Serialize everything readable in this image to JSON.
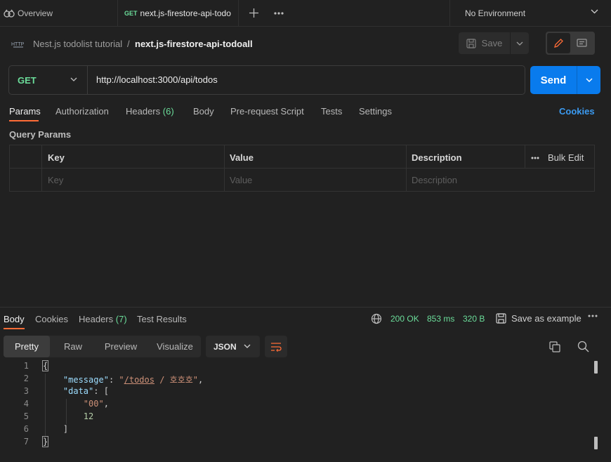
{
  "tabs": {
    "overview_label": "Overview",
    "request_method": "GET",
    "request_label": "next.js-firestore-api-todo",
    "environment": "No Environment"
  },
  "breadcrumb": {
    "parent": "Nest.js todolist tutorial",
    "separator": "/",
    "current": "next.js-firestore-api-todoall"
  },
  "toolbar": {
    "save_label": "Save"
  },
  "request": {
    "method": "GET",
    "url": "http://localhost:3000/api/todos",
    "send_label": "Send"
  },
  "request_tabs": {
    "params": "Params",
    "authorization": "Authorization",
    "headers": "Headers",
    "headers_count": "(6)",
    "body": "Body",
    "pre_request": "Pre-request Script",
    "tests": "Tests",
    "settings": "Settings",
    "cookies": "Cookies"
  },
  "query_params": {
    "title": "Query Params",
    "columns": [
      "Key",
      "Value",
      "Description"
    ],
    "bulk_edit": "Bulk Edit",
    "placeholders": [
      "Key",
      "Value",
      "Description"
    ]
  },
  "response_tabs": {
    "body": "Body",
    "cookies": "Cookies",
    "headers": "Headers",
    "headers_count": "(7)",
    "test_results": "Test Results"
  },
  "response_status": {
    "status": "200 OK",
    "time": "853 ms",
    "size": "320 B",
    "save_example": "Save as example"
  },
  "format": {
    "pretty": "Pretty",
    "raw": "Raw",
    "preview": "Preview",
    "visualize": "Visualize",
    "language": "JSON"
  },
  "code": {
    "line_numbers": [
      "1",
      "2",
      "3",
      "4",
      "5",
      "6",
      "7"
    ],
    "open_brace": "{",
    "message_key": "\"message\"",
    "colon": ": ",
    "message_value_q1": "\"",
    "message_value_link": "/todos",
    "message_value_rest": " / 호호호\"",
    "comma": ",",
    "data_key": "\"data\"",
    "data_open": ": [",
    "item_1": "\"00\"",
    "item_2": "12",
    "close_bracket": "]",
    "close_brace": "}"
  },
  "colors": {
    "accent_orange": "#ff6c37",
    "send_blue": "#097bed",
    "method_green": "#6bdd9a",
    "link_blue": "#3b9bf2"
  }
}
